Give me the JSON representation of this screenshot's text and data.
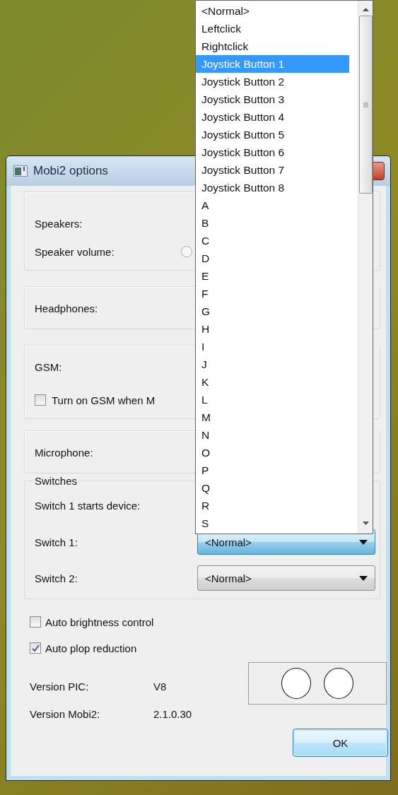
{
  "window": {
    "title": "Mobi2 options"
  },
  "groups": [
    {
      "rows": [
        {
          "kind": "plain",
          "label": "Speakers:"
        },
        {
          "kind": "radio",
          "label": "Speaker volume:",
          "selected": false
        }
      ]
    },
    {
      "rows": [
        {
          "kind": "plain",
          "label": "Headphones:"
        }
      ]
    },
    {
      "rows": [
        {
          "kind": "plain",
          "label": "GSM:"
        },
        {
          "kind": "checkbox",
          "label": "Turn on GSM when M",
          "checked": false
        }
      ]
    },
    {
      "rows": [
        {
          "kind": "plain",
          "label": "Microphone:"
        }
      ]
    }
  ],
  "switches": {
    "title": "Switches",
    "rows": [
      {
        "label": "Switch 1 starts device:"
      },
      {
        "label": "Switch 1:",
        "value": "<Normal>",
        "focused": true
      },
      {
        "label": "Switch 2:",
        "value": "<Normal>",
        "focused": false
      }
    ]
  },
  "options": [
    {
      "label": "Auto brightness control",
      "checked": false
    },
    {
      "label": "Auto plop reduction",
      "checked": true
    }
  ],
  "versions": [
    {
      "label": "Version PIC:",
      "value": "V8"
    },
    {
      "label": "Version Mobi2:",
      "value": "2.1.0.30"
    }
  ],
  "ok_button": "OK",
  "dropdown": {
    "items": [
      {
        "label": "<Normal>",
        "selected": false
      },
      {
        "label": "Leftclick",
        "selected": false
      },
      {
        "label": "Rightclick",
        "selected": false
      },
      {
        "label": "Joystick Button 1",
        "selected": true
      },
      {
        "label": "Joystick Button 2",
        "selected": false
      },
      {
        "label": "Joystick Button 3",
        "selected": false
      },
      {
        "label": "Joystick Button 4",
        "selected": false
      },
      {
        "label": "Joystick Button 5",
        "selected": false
      },
      {
        "label": "Joystick Button 6",
        "selected": false
      },
      {
        "label": "Joystick Button 7",
        "selected": false
      },
      {
        "label": "Joystick Button 8",
        "selected": false
      },
      {
        "label": "A",
        "selected": false
      },
      {
        "label": "B",
        "selected": false
      },
      {
        "label": "C",
        "selected": false
      },
      {
        "label": "D",
        "selected": false
      },
      {
        "label": "E",
        "selected": false
      },
      {
        "label": "F",
        "selected": false
      },
      {
        "label": "G",
        "selected": false
      },
      {
        "label": "H",
        "selected": false
      },
      {
        "label": "I",
        "selected": false
      },
      {
        "label": "J",
        "selected": false
      },
      {
        "label": "K",
        "selected": false
      },
      {
        "label": "L",
        "selected": false
      },
      {
        "label": "M",
        "selected": false
      },
      {
        "label": "N",
        "selected": false
      },
      {
        "label": "O",
        "selected": false
      },
      {
        "label": "P",
        "selected": false
      },
      {
        "label": "Q",
        "selected": false
      },
      {
        "label": "R",
        "selected": false
      },
      {
        "label": "S",
        "selected": false
      }
    ]
  }
}
